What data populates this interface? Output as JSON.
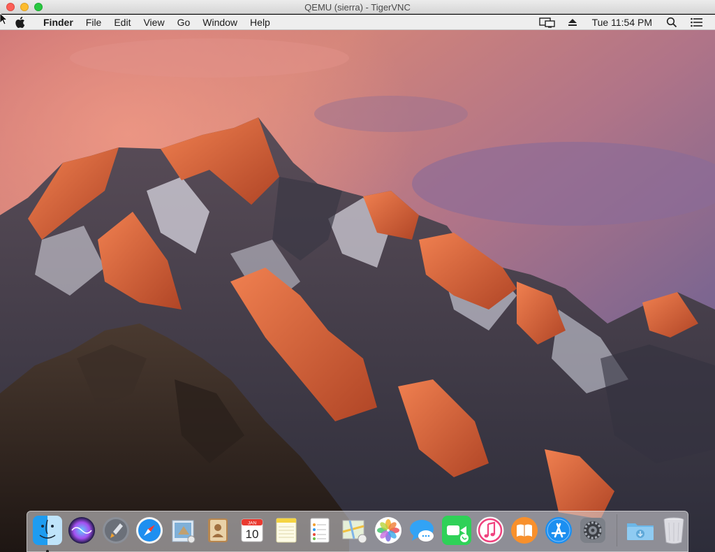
{
  "window": {
    "title": "QEMU (sierra) - TigerVNC"
  },
  "menubar": {
    "app_name": "Finder",
    "items": [
      "File",
      "Edit",
      "View",
      "Go",
      "Window",
      "Help"
    ],
    "clock": "Tue 11:54 PM",
    "status_icons": [
      "display-mirroring-icon",
      "eject-icon",
      "spotlight-search-icon",
      "notification-center-icon"
    ]
  },
  "desktop": {
    "wallpaper": "macOS Sierra mountain wallpaper"
  },
  "dock": {
    "items": [
      {
        "name": "finder",
        "running": true
      },
      {
        "name": "siri"
      },
      {
        "name": "launchpad"
      },
      {
        "name": "safari"
      },
      {
        "name": "mail"
      },
      {
        "name": "contacts"
      },
      {
        "name": "calendar",
        "month": "JAN",
        "day": "10"
      },
      {
        "name": "notes"
      },
      {
        "name": "reminders"
      },
      {
        "name": "maps"
      },
      {
        "name": "photos"
      },
      {
        "name": "messages"
      },
      {
        "name": "facetime"
      },
      {
        "name": "itunes"
      },
      {
        "name": "ibooks"
      },
      {
        "name": "app-store"
      },
      {
        "name": "system-preferences"
      },
      {
        "name": "downloads"
      },
      {
        "name": "trash"
      }
    ]
  },
  "colors": {
    "menubar_bg": "#f6f6f6",
    "close": "#fc5f57",
    "minimize": "#fdbc2e",
    "zoom": "#28c840",
    "sky_top": "#c97a82",
    "sky_purple": "#6e5a86",
    "mountain_glow": "#e06a3a"
  }
}
